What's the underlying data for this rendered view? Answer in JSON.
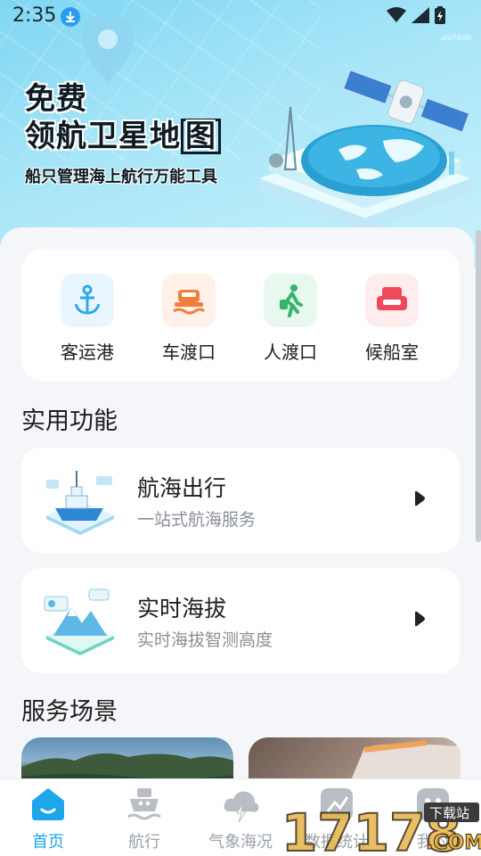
{
  "status_bar": {
    "time": "2:35",
    "code": "a6f766fc"
  },
  "hero": {
    "title_line1": "免费",
    "title_line2_prefix": "领航卫星地",
    "title_line2_boxed": "图",
    "subtitle": "船只管理海上航行万能工具"
  },
  "quick_actions": [
    {
      "label": "客运港",
      "icon": "anchor-icon",
      "bg": "#eaf6ff",
      "color": "#2fa7ef"
    },
    {
      "label": "车渡口",
      "icon": "car-ferry-icon",
      "bg": "#fff1e8",
      "color": "#f07d3a"
    },
    {
      "label": "人渡口",
      "icon": "walking-person-icon",
      "bg": "#e9f8ef",
      "color": "#35b56a"
    },
    {
      "label": "候船室",
      "icon": "waiting-seat-icon",
      "bg": "#ffedee",
      "color": "#ef4a5b"
    }
  ],
  "sections": {
    "practical": "实用功能",
    "scenes": "服务场景"
  },
  "features": [
    {
      "title": "航海出行",
      "subtitle": "一站式航海服务",
      "icon": "ship-illustration-icon"
    },
    {
      "title": "实时海拔",
      "subtitle": "实时海拔智测高度",
      "icon": "mountain-altitude-icon"
    }
  ],
  "bottom_nav": [
    {
      "label": "首页",
      "icon": "home-icon",
      "active": true
    },
    {
      "label": "航行",
      "icon": "ship-icon",
      "active": false
    },
    {
      "label": "气象海况",
      "icon": "weather-icon",
      "active": false
    },
    {
      "label": "数据统计",
      "icon": "chart-icon",
      "active": false
    },
    {
      "label": "我的",
      "icon": "profile-icon",
      "active": false
    }
  ],
  "watermark": {
    "number": "17178",
    "tag": "下载站",
    "domain": ".COM"
  },
  "colors": {
    "accent": "#1da6ea",
    "muted": "#9aa0a8"
  }
}
